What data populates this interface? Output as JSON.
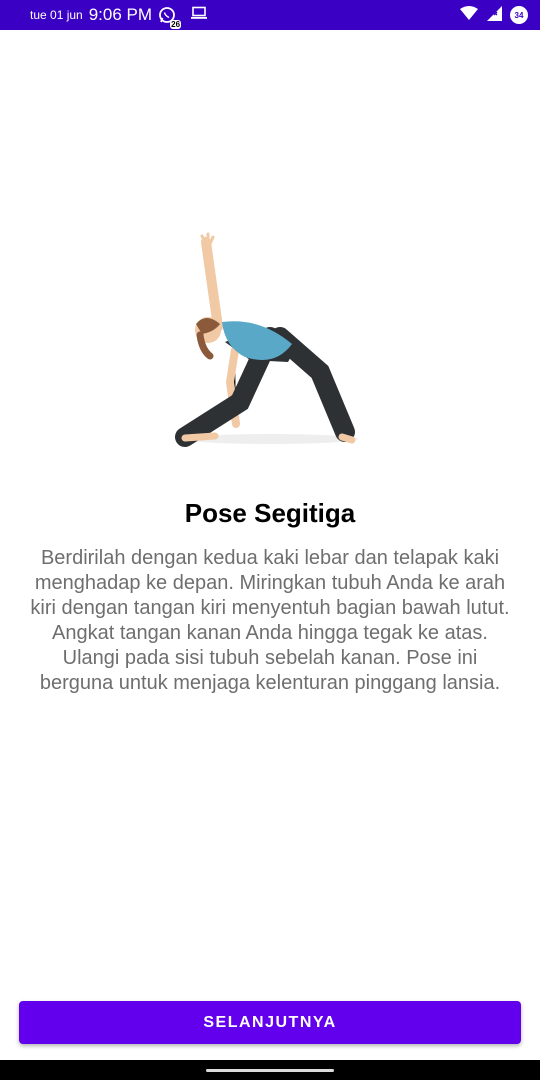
{
  "status_bar": {
    "date": "tue 01 jun",
    "time": "9:06 PM",
    "whatsapp_badge": "26",
    "battery_level": "34",
    "icons": [
      "whatsapp-icon",
      "laptop-icon",
      "wifi-icon",
      "signal-icon",
      "battery-icon"
    ]
  },
  "pose": {
    "illustration": "triangle-pose-illustration",
    "title": "Pose Segitiga",
    "description": "Berdirilah dengan kedua kaki lebar dan telapak kaki menghadap ke depan. Miringkan tubuh Anda ke arah kiri dengan tangan kiri menyentuh bagian bawah lutut. Angkat tangan kanan Anda hingga tegak ke atas. Ulangi pada sisi tubuh sebelah kanan. Pose ini berguna untuk menjaga kelenturan pinggang lansia."
  },
  "footer": {
    "next_label": "SELANJUTNYA"
  },
  "colors": {
    "status_bar": "#3a00c4",
    "primary": "#6200ee",
    "description_text": "#6e6e6e"
  }
}
